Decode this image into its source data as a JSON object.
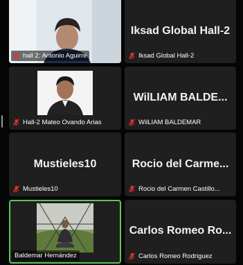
{
  "participants": [
    {
      "display": "",
      "label": "hall 2: Antonio Aguirre",
      "muted": true,
      "video": true,
      "active": false
    },
    {
      "display": "Iksad Global Hall-2",
      "label": "Iksad Global Hall-2",
      "muted": true,
      "video": false,
      "active": false
    },
    {
      "display": "",
      "label": "Hall-2 Mateo Ovando Arias",
      "muted": true,
      "video": true,
      "active": false
    },
    {
      "display": "WilLIAM BALDE...",
      "label": "WilLIAM BALDEMAR",
      "muted": true,
      "video": false,
      "active": false
    },
    {
      "display": "Mustieles10",
      "label": "Mustieles10",
      "muted": true,
      "video": false,
      "active": false
    },
    {
      "display": "Rocio del Carme...",
      "label": "Rocio del Carmen Castillo...",
      "muted": true,
      "video": false,
      "active": false
    },
    {
      "display": "",
      "label": "Baldemar Hernández",
      "muted": false,
      "video": true,
      "active": true
    },
    {
      "display": "Carlos Romeo Ro...",
      "label": "Carlos Romeo Rodriguez",
      "muted": true,
      "video": false,
      "active": false
    }
  ],
  "icons": {
    "muted": "mic-muted-icon"
  },
  "colors": {
    "active_border": "#58c85a",
    "muted_mic": "#e5302d",
    "tile_bg": "#1f1f1f"
  }
}
